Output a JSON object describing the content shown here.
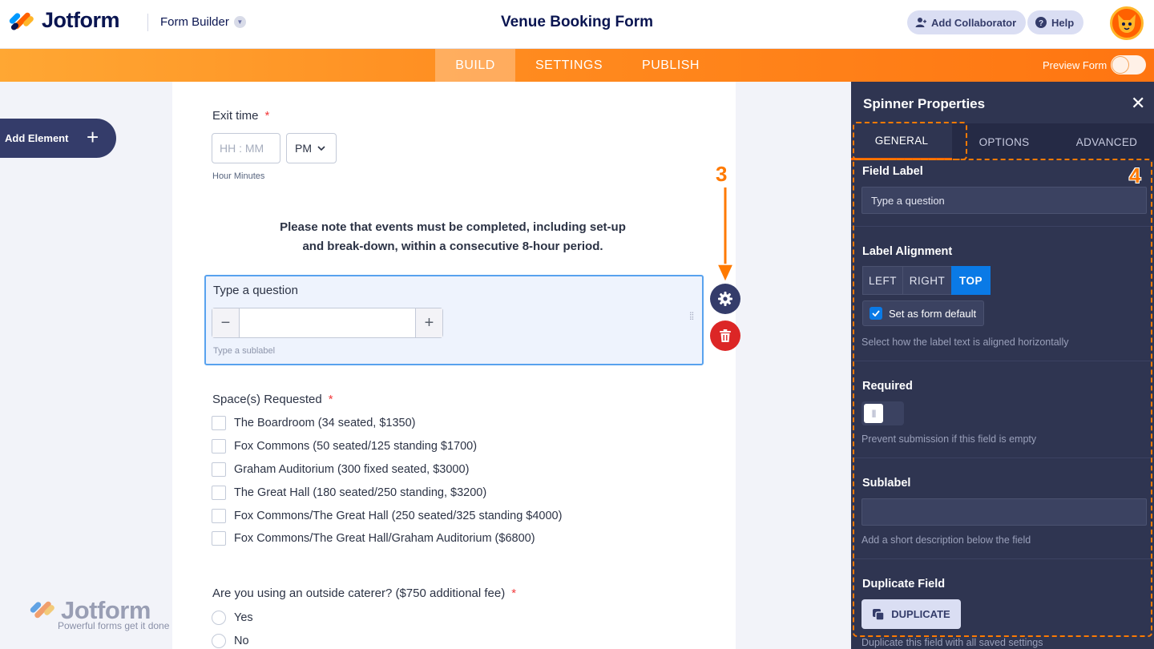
{
  "header": {
    "brand": "Jotform",
    "builder_label": "Form Builder",
    "form_title": "Venue Booking Form",
    "add_collaborator": "Add Collaborator",
    "help": "Help"
  },
  "nav": {
    "tabs": [
      {
        "label": "BUILD",
        "active": true
      },
      {
        "label": "SETTINGS",
        "active": false
      },
      {
        "label": "PUBLISH",
        "active": false
      }
    ],
    "preview_label": "Preview Form"
  },
  "sidebar": {
    "add_element": "Add Element"
  },
  "form": {
    "exit_time": {
      "label": "Exit time",
      "required_mark": "*",
      "placeholder": "HH : MM",
      "ampm": "PM",
      "sublabel": "Hour Minutes"
    },
    "notice_line1": "Please note that events must be completed, including set-up",
    "notice_line2": "and break-down, within a consecutive 8-hour period.",
    "spinner": {
      "label": "Type a question",
      "minus": "−",
      "plus": "+",
      "sublabel": "Type a sublabel"
    },
    "spaces": {
      "label": "Space(s) Requested",
      "required_mark": "*",
      "options": [
        "The Boardroom (34 seated, $1350)",
        "Fox Commons (50 seated/125 standing $1700)",
        "Graham Auditorium (300 fixed seated, $3000)",
        "The Great Hall (180 seated/250 standing, $3200)",
        "Fox Commons/The Great Hall (250 seated/325 standing $4000)",
        "Fox Commons/The Great Hall/Graham Auditorium ($6800)"
      ]
    },
    "caterer": {
      "label": "Are you using an outside caterer? ($750 additional fee)",
      "required_mark": "*",
      "options": [
        "Yes",
        "No"
      ]
    }
  },
  "annotations": {
    "step3": "3",
    "step4": "4"
  },
  "watermark": {
    "brand": "Jotform",
    "tagline": "Powerful forms get it done"
  },
  "panel": {
    "title": "Spinner Properties",
    "tabs": [
      "GENERAL",
      "OPTIONS",
      "ADVANCED"
    ],
    "active_tab": "GENERAL",
    "field_label": {
      "title": "Field Label",
      "value": "Type a question"
    },
    "label_alignment": {
      "title": "Label Alignment",
      "options": [
        "LEFT",
        "RIGHT",
        "TOP"
      ],
      "selected": "TOP",
      "default_checkbox": "Set as form default",
      "description": "Select how the label text is aligned horizontally"
    },
    "required": {
      "title": "Required",
      "enabled": false,
      "description": "Prevent submission if this field is empty"
    },
    "sublabel": {
      "title": "Sublabel",
      "value": "",
      "description": "Add a short description below the field"
    },
    "duplicate": {
      "title": "Duplicate Field",
      "button": "DUPLICATE",
      "description": "Duplicate this field with all saved settings"
    }
  },
  "colors": {
    "accent_orange": "#ff7a00",
    "navy": "#0a1551",
    "panel_bg": "#2f3551",
    "selected_blue": "#0a7ae6",
    "delete_red": "#dc2626"
  }
}
